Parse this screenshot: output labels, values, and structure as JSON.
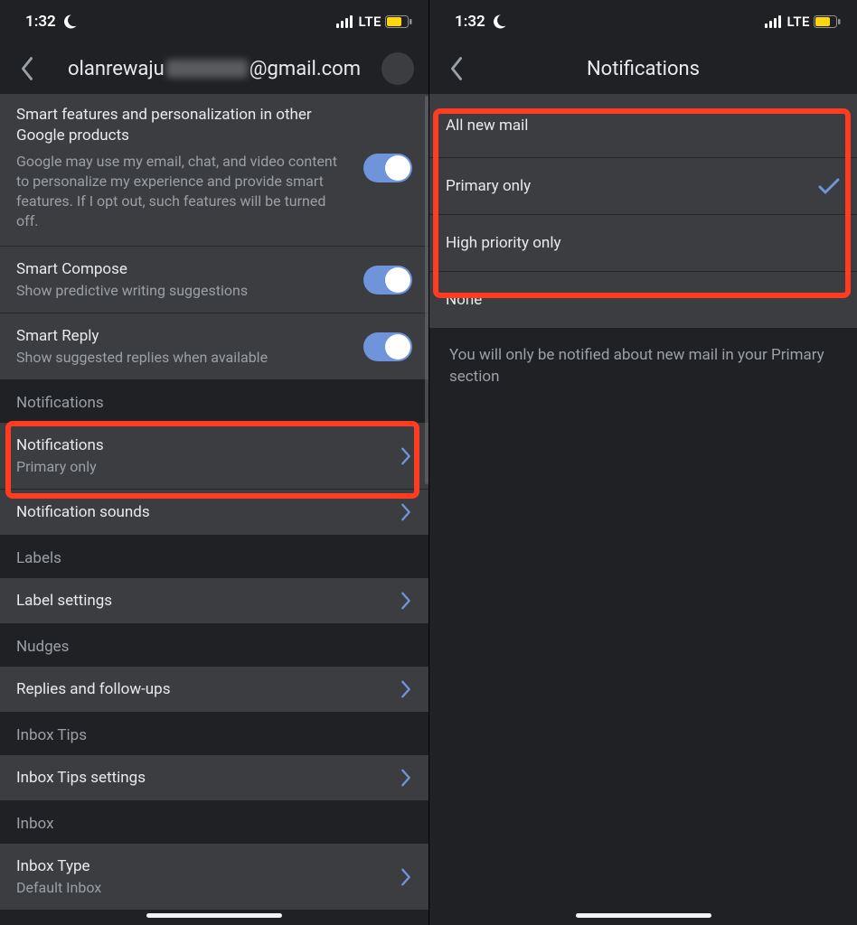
{
  "status": {
    "time": "1:32",
    "network_label": "LTE"
  },
  "left": {
    "header_prefix": "olanrewaju",
    "header_suffix": "@gmail.com",
    "smart_personalization": {
      "title": "Smart features and personalization in other Google products",
      "desc": "Google may use my email, chat, and video content to personalize my experience and provide smart features. If I opt out, such features will be turned off."
    },
    "smart_compose": {
      "title": "Smart Compose",
      "sub": "Show predictive writing suggestions"
    },
    "smart_reply": {
      "title": "Smart Reply",
      "sub": "Show suggested replies when available"
    },
    "section_notifications": "Notifications",
    "notifications": {
      "title": "Notifications",
      "sub": "Primary only"
    },
    "notification_sounds": {
      "title": "Notification sounds"
    },
    "section_labels": "Labels",
    "label_settings": {
      "title": "Label settings"
    },
    "section_nudges": "Nudges",
    "replies_followups": {
      "title": "Replies and follow-ups"
    },
    "section_inbox_tips": "Inbox Tips",
    "inbox_tips_settings": {
      "title": "Inbox Tips settings"
    },
    "section_inbox": "Inbox",
    "inbox_type": {
      "title": "Inbox Type",
      "sub": "Default Inbox"
    }
  },
  "right": {
    "title": "Notifications",
    "options": {
      "all": "All new mail",
      "primary": "Primary only",
      "high": "High priority only",
      "none": "None"
    },
    "selected": "primary",
    "footer": "You will only be notified about new mail in your Primary section"
  }
}
